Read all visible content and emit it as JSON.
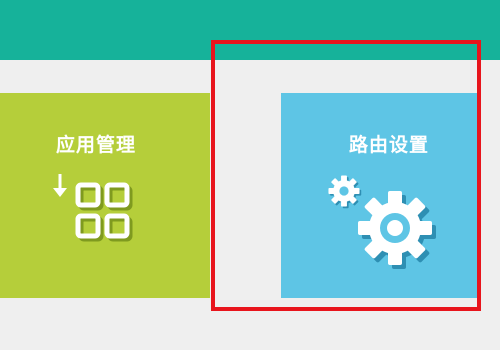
{
  "header": {
    "color": "#16b29a"
  },
  "tiles": [
    {
      "label": "应用管理",
      "icon": "app-grid-download-icon",
      "color": "#b5ce3a"
    },
    {
      "label": "路由设置",
      "icon": "settings-gears-icon",
      "color": "#5ec5e5"
    }
  ],
  "highlight": {
    "color": "#e8141c"
  }
}
